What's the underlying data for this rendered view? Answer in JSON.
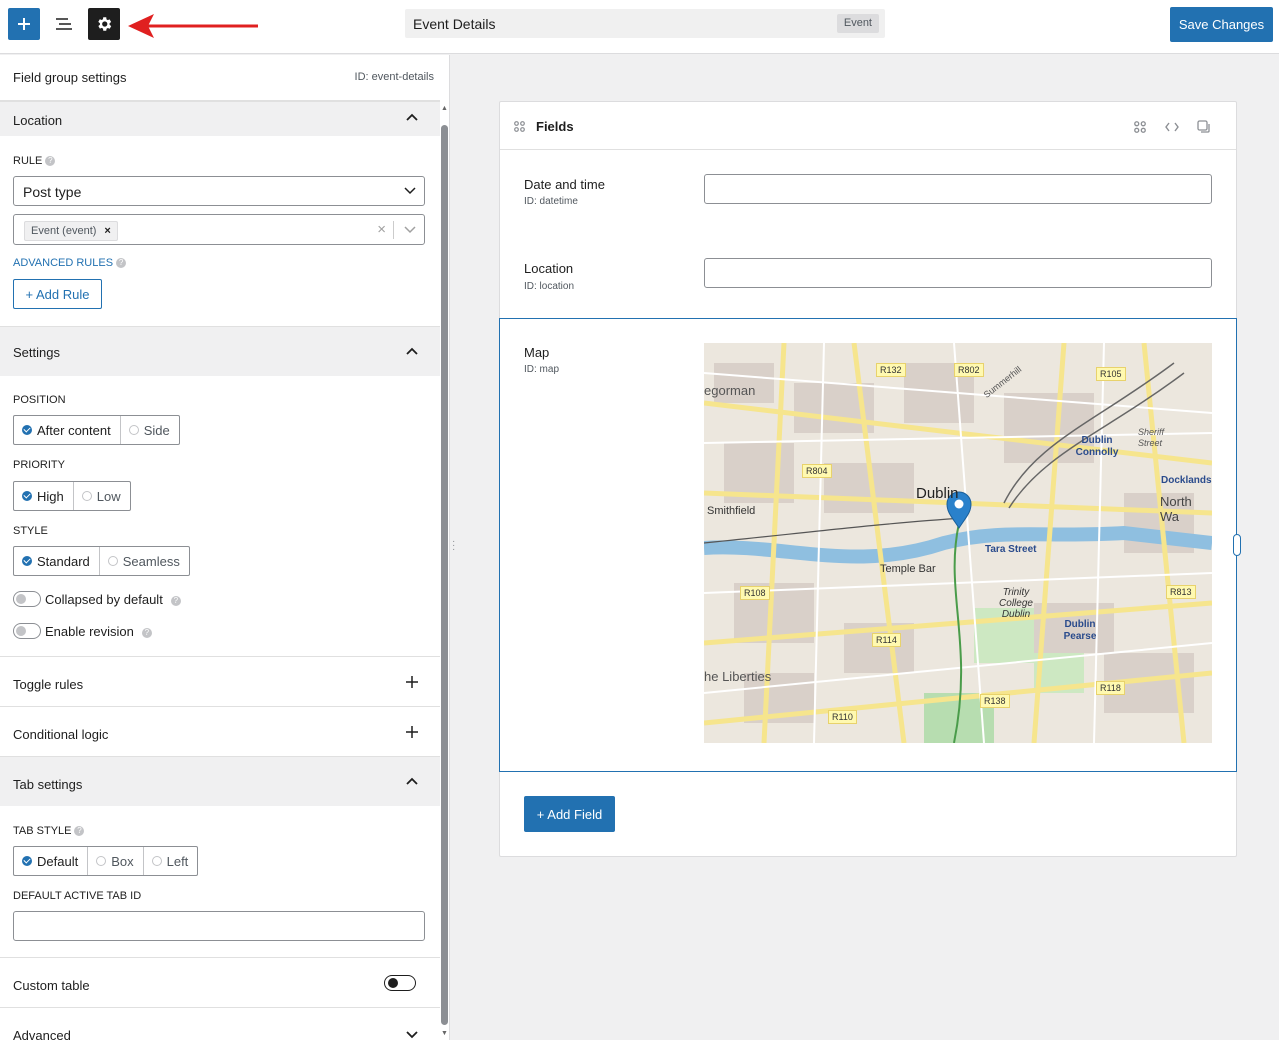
{
  "topbar": {
    "title": "Event Details",
    "badge": "Event",
    "save_label": "Save Changes"
  },
  "sidebar": {
    "header_title": "Field group settings",
    "header_id": "ID: event-details",
    "location": {
      "title": "Location",
      "rule_label": "RULE",
      "rule_value": "Post type",
      "tag": "Event (event)",
      "advanced_rules": "ADVANCED RULES",
      "add_rule": "+ Add Rule"
    },
    "settings": {
      "title": "Settings",
      "position_label": "POSITION",
      "position_options": [
        "After content",
        "Side"
      ],
      "priority_label": "PRIORITY",
      "priority_options": [
        "High",
        "Low"
      ],
      "style_label": "STYLE",
      "style_options": [
        "Standard",
        "Seamless"
      ],
      "collapsed_label": "Collapsed by default",
      "revision_label": "Enable revision"
    },
    "toggle_rules": "Toggle rules",
    "conditional_logic": "Conditional logic",
    "tab_settings": {
      "title": "Tab settings",
      "tab_style_label": "TAB STYLE",
      "tab_style_options": [
        "Default",
        "Box",
        "Left"
      ],
      "default_tab_label": "DEFAULT ACTIVE TAB ID"
    },
    "custom_table": "Custom table",
    "advanced": "Advanced"
  },
  "panel": {
    "title": "Fields",
    "fields": [
      {
        "name": "Date and time",
        "id": "ID: datetime"
      },
      {
        "name": "Location",
        "id": "ID: location"
      },
      {
        "name": "Map",
        "id": "ID: map"
      }
    ],
    "add_field": "+ Add Field"
  },
  "map": {
    "labels": [
      "Dublin",
      "Smithfield",
      "Temple Bar",
      "Tara Street",
      "Trinity College Dublin",
      "Dublin Connolly",
      "Docklands",
      "North Wa",
      "Dublin Pearse",
      "he Liberties",
      "egorman",
      "Sheriff Street",
      "Summerhill"
    ],
    "roads": [
      "R132",
      "R802",
      "R105",
      "R804",
      "R108",
      "R114",
      "R813",
      "R118",
      "R138",
      "R110"
    ]
  },
  "colors": {
    "accent": "#2271b1",
    "dark": "#1e1e1e"
  }
}
